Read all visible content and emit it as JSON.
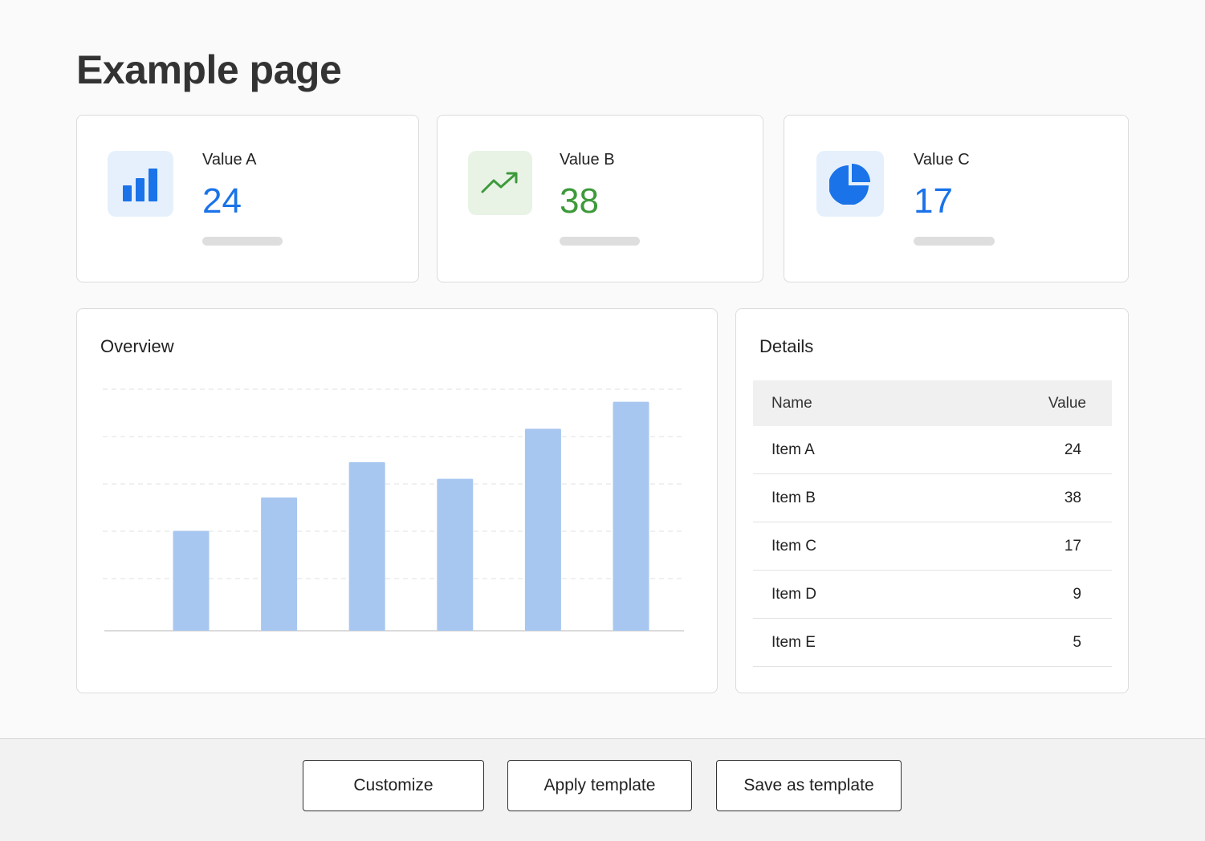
{
  "page": {
    "title": "Example page"
  },
  "stats": [
    {
      "label": "Value A",
      "value": "24",
      "color": "#1a73e8",
      "icon_bg": "#e6f0fc",
      "icon": "bar-chart-icon"
    },
    {
      "label": "Value B",
      "value": "38",
      "color": "#3d9a3a",
      "icon_bg": "#e8f3e6",
      "icon": "trending-up-icon"
    },
    {
      "label": "Value C",
      "value": "17",
      "color": "#1a73e8",
      "icon_bg": "#e6f0fc",
      "icon": "pie-chart-icon"
    }
  ],
  "overview": {
    "title": "Overview",
    "chart_data": {
      "type": "bar",
      "categories": [
        "",
        "",
        "",
        "",
        "",
        ""
      ],
      "values": [
        24,
        32,
        40.5,
        36.5,
        48.5,
        55
      ],
      "ylim": [
        0,
        58
      ],
      "grid": true,
      "bar_color": "#a8c7f0"
    }
  },
  "details": {
    "title": "Details",
    "columns": [
      "Name",
      "Value"
    ],
    "rows": [
      {
        "name": "Item A",
        "value": "24"
      },
      {
        "name": "Item B",
        "value": "38"
      },
      {
        "name": "Item C",
        "value": "17"
      },
      {
        "name": "Item D",
        "value": "9"
      },
      {
        "name": "Item E",
        "value": "5"
      }
    ]
  },
  "footer": {
    "customize_label": "Customize",
    "apply_label": "Apply template",
    "save_label": "Save as template"
  }
}
